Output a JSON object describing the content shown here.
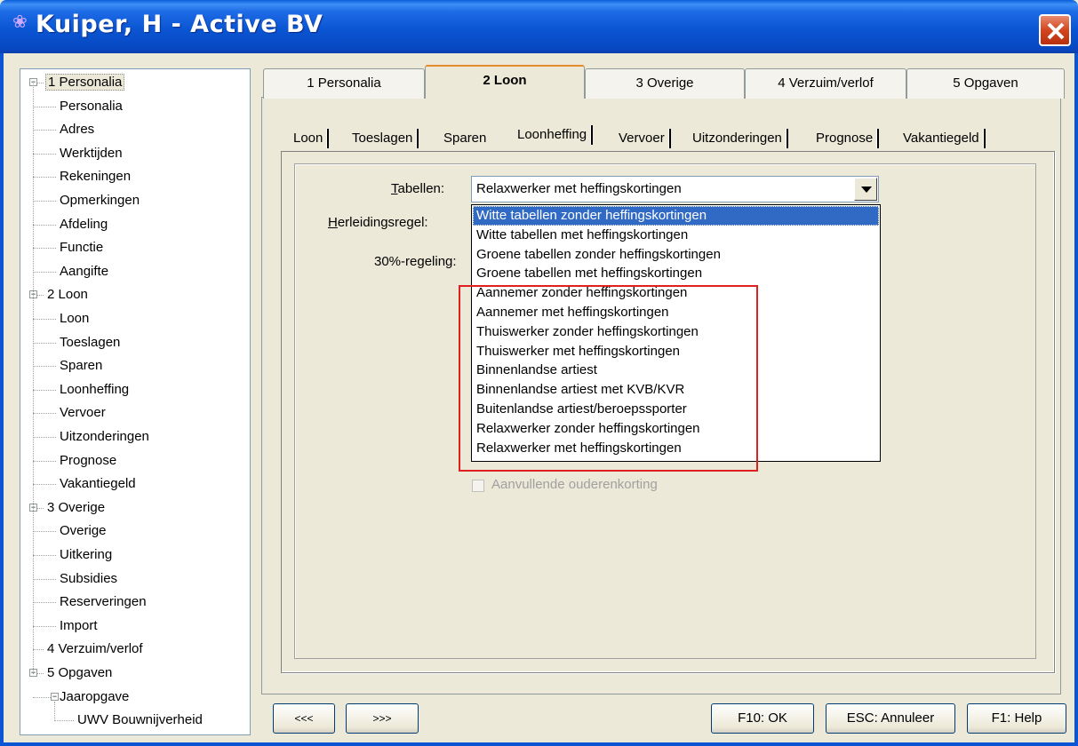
{
  "window": {
    "title": "Kuiper, H - Active BV"
  },
  "tree": {
    "items": [
      {
        "label": "1 Personalia",
        "level": 0
      },
      {
        "label": "Personalia",
        "level": 1
      },
      {
        "label": "Adres",
        "level": 1
      },
      {
        "label": "Werktijden",
        "level": 1
      },
      {
        "label": "Rekeningen",
        "level": 1
      },
      {
        "label": "Opmerkingen",
        "level": 1
      },
      {
        "label": "Afdeling",
        "level": 1
      },
      {
        "label": "Functie",
        "level": 1
      },
      {
        "label": "Aangifte",
        "level": 1
      },
      {
        "label": "2 Loon",
        "level": 0
      },
      {
        "label": "Loon",
        "level": 1
      },
      {
        "label": "Toeslagen",
        "level": 1
      },
      {
        "label": "Sparen",
        "level": 1
      },
      {
        "label": "Loonheffing",
        "level": 1
      },
      {
        "label": "Vervoer",
        "level": 1
      },
      {
        "label": "Uitzonderingen",
        "level": 1
      },
      {
        "label": "Prognose",
        "level": 1
      },
      {
        "label": "Vakantiegeld",
        "level": 1
      },
      {
        "label": "3 Overige",
        "level": 0
      },
      {
        "label": "Overige",
        "level": 1
      },
      {
        "label": "Uitkering",
        "level": 1
      },
      {
        "label": "Subsidies",
        "level": 1
      },
      {
        "label": "Reserveringen",
        "level": 1
      },
      {
        "label": "Import",
        "level": 1
      },
      {
        "label": "4 Verzuim/verlof",
        "level": 0
      },
      {
        "label": "5 Opgaven",
        "level": 0
      },
      {
        "label": "Jaaropgave",
        "level": 1
      },
      {
        "label": "UWV Bouwnijverheid",
        "level": 2
      }
    ]
  },
  "tabs": [
    "1 Personalia",
    "2 Loon",
    "3 Overige",
    "4 Verzuim/verlof",
    "5 Opgaven"
  ],
  "active_tab": "2 Loon",
  "subtabs": [
    "Loon",
    "Toeslagen",
    "Sparen",
    "Loonheffing",
    "Vervoer",
    "Uitzonderingen",
    "Prognose",
    "Vakantiegeld"
  ],
  "active_subtab": "Loonheffing",
  "form": {
    "tabellen_label": "Tabellen:",
    "tabellen_value": "Relaxwerker met heffingskortingen",
    "herleidingsregel_label": "Herleidingsregel:",
    "regeling_label": "30%-regeling:",
    "checkbox_label": "Aanvullende ouderenkorting"
  },
  "dropdown": {
    "options": [
      "Witte tabellen zonder heffingskortingen",
      "Witte tabellen met heffingskortingen",
      "Groene tabellen zonder heffingskortingen",
      "Groene tabellen met heffingskortingen",
      "Aannemer zonder heffingskortingen",
      "Aannemer met heffingskortingen",
      "Thuiswerker zonder heffingskortingen",
      "Thuiswerker met heffingskortingen",
      "Binnenlandse artiest",
      "Binnenlandse artiest met KVB/KVR",
      "Buitenlandse artiest/beroepssporter",
      "Relaxwerker zonder heffingskortingen",
      "Relaxwerker met heffingskortingen"
    ],
    "highlighted": "Witte tabellen zonder heffingskortingen",
    "annotation_color": "#e02020"
  },
  "buttons": {
    "prev": "<<<",
    "next": ">>>",
    "ok": "F10: OK",
    "cancel": "ESC: Annuleer",
    "help": "F1: Help"
  }
}
